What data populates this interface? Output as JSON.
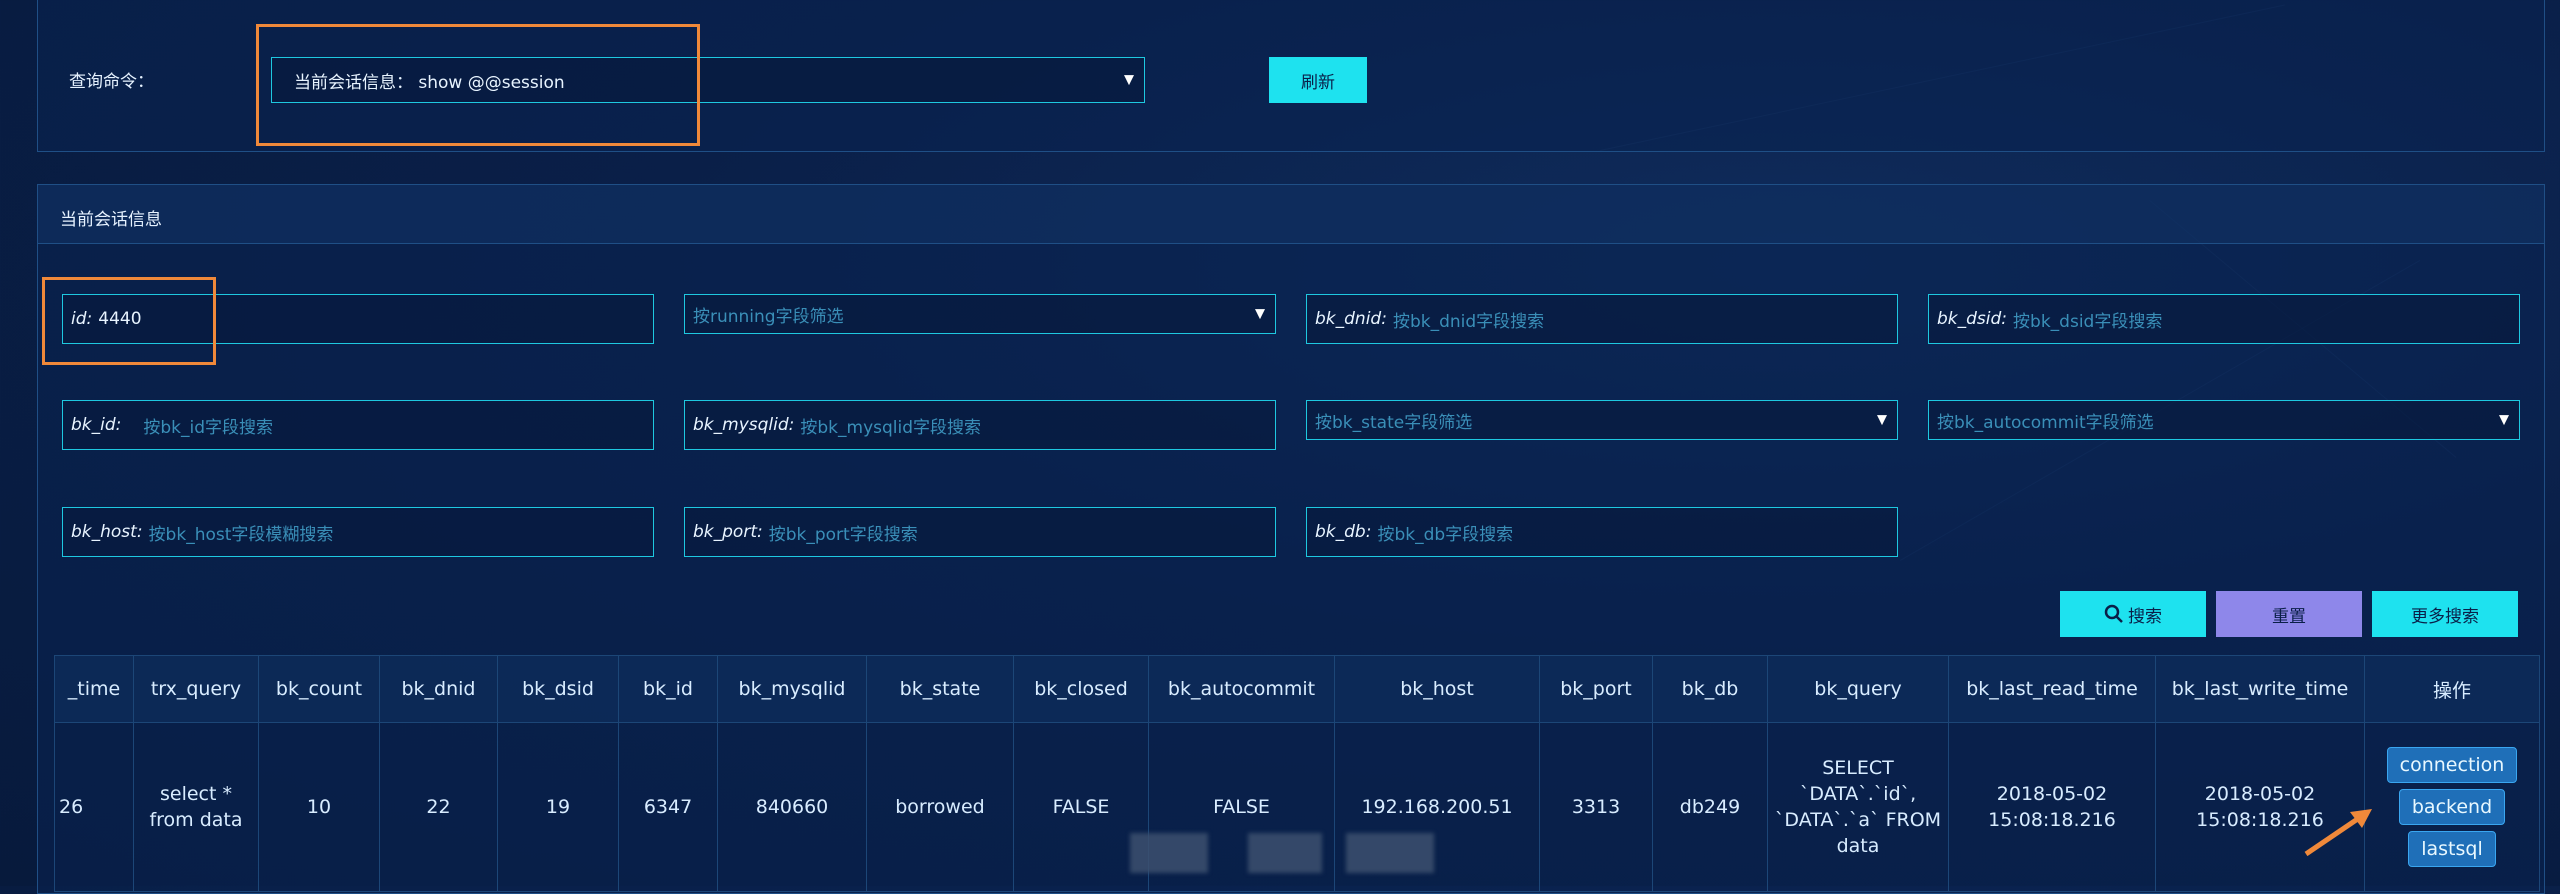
{
  "query_bar": {
    "label": "查询命令：",
    "select_value": "当前会话信息：  show @@session",
    "refresh_label": "刷新"
  },
  "section": {
    "title": "当前会话信息"
  },
  "filters": {
    "id": {
      "key": "id:",
      "value": "4440"
    },
    "running": {
      "placeholder": "按running字段筛选"
    },
    "bk_dnid": {
      "key": "bk_dnid:",
      "placeholder": "按bk_dnid字段搜索"
    },
    "bk_dsid": {
      "key": "bk_dsid:",
      "placeholder": "按bk_dsid字段搜索"
    },
    "bk_id": {
      "key": "bk_id:",
      "placeholder": "按bk_id字段搜索"
    },
    "bk_mysqlid": {
      "key": "bk_mysqlid:",
      "placeholder": "按bk_mysqlid字段搜索"
    },
    "bk_state": {
      "placeholder": "按bk_state字段筛选"
    },
    "bk_autocommit": {
      "placeholder": "按bk_autocommit字段筛选"
    },
    "bk_host": {
      "key": "bk_host:",
      "placeholder": "按bk_host字段模糊搜索"
    },
    "bk_port": {
      "key": "bk_port:",
      "placeholder": "按bk_port字段搜索"
    },
    "bk_db": {
      "key": "bk_db:",
      "placeholder": "按bk_db字段搜索"
    }
  },
  "actions": {
    "search_label": "搜索",
    "reset_label": "重置",
    "more_label": "更多搜索"
  },
  "table": {
    "headers": [
      "_time",
      "trx_query",
      "bk_count",
      "bk_dnid",
      "bk_dsid",
      "bk_id",
      "bk_mysqlid",
      "bk_state",
      "bk_closed",
      "bk_autocommit",
      "bk_host",
      "bk_port",
      "bk_db",
      "bk_query",
      "bk_last_read_time",
      "bk_last_write_time",
      "操作"
    ],
    "row": {
      "time": "26",
      "trx_query": "select * from data",
      "bk_count": "10",
      "bk_dnid": "22",
      "bk_dsid": "19",
      "bk_id": "6347",
      "bk_mysqlid": "840660",
      "bk_state": "borrowed",
      "bk_closed": "FALSE",
      "bk_autocommit": "FALSE",
      "bk_host": "192.168.200.51",
      "bk_port": "3313",
      "bk_db": "db249",
      "bk_query": "SELECT `DATA`.`id`, `DATA`.`a` FROM data",
      "bk_last_read_time": "2018-05-02 15:08:18.216",
      "bk_last_write_time": "2018-05-02 15:08:18.216",
      "ops": [
        "connection",
        "backend",
        "lastsql"
      ]
    }
  },
  "colors": {
    "accent": "#1ee2ef",
    "highlight": "#f0893a",
    "reset_button": "#8e87ea",
    "background": "#0a1f48"
  }
}
